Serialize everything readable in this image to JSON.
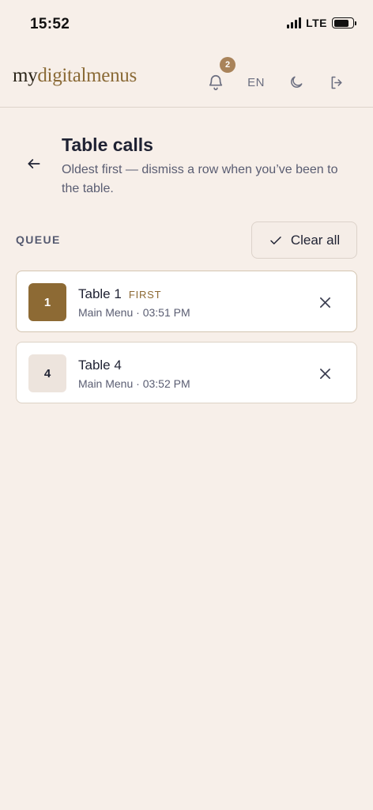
{
  "status_bar": {
    "time": "15:52",
    "network": "LTE"
  },
  "header": {
    "logo_my": "my",
    "logo_rest": "digitalmenus",
    "notification_count": "2",
    "language": "EN",
    "icons": [
      "bell-icon",
      "moon-icon",
      "logout-icon"
    ]
  },
  "page": {
    "title": "Table calls",
    "subtitle": "Oldest first — dismiss a row when you’ve been to the table."
  },
  "queue": {
    "label": "QUEUE",
    "clear_all_label": "Clear all",
    "rows": [
      {
        "number": "1",
        "title": "Table 1",
        "tag": "FIRST",
        "menu": "Main Menu",
        "separator": " · ",
        "time": "03:51 PM"
      },
      {
        "number": "4",
        "title": "Table 4",
        "tag": "",
        "menu": "Main Menu",
        "separator": " · ",
        "time": "03:52 PM"
      }
    ]
  },
  "colors": {
    "background": "#f7efe9",
    "accent": "#8d6a34",
    "badge": "#a9835a",
    "text": "#1f2233"
  }
}
